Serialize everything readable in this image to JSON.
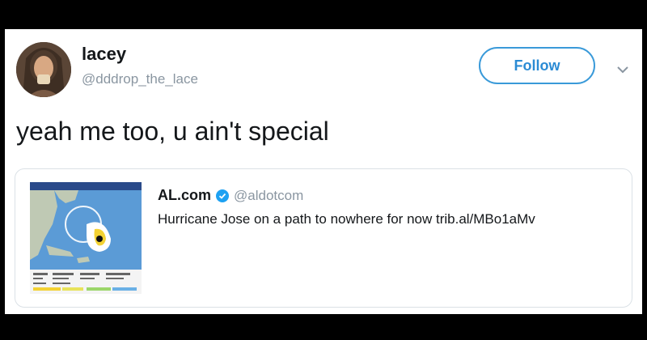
{
  "tweet": {
    "display_name": "lacey",
    "handle": "@dddrop_the_lace",
    "follow_label": "Follow",
    "text": "yeah me too, u ain't special"
  },
  "quoted_tweet": {
    "display_name": "AL.com",
    "handle": "@aldotcom",
    "text": "Hurricane Jose on a path to nowhere for now trib.al/MBo1aMv"
  },
  "colors": {
    "accent": "#2b8bd4",
    "text": "#14171a",
    "secondary_text": "#8a96a1"
  },
  "icons": [
    "avatar",
    "chevron-down-icon",
    "verified-badge-icon",
    "hurricane-map-thumbnail"
  ]
}
